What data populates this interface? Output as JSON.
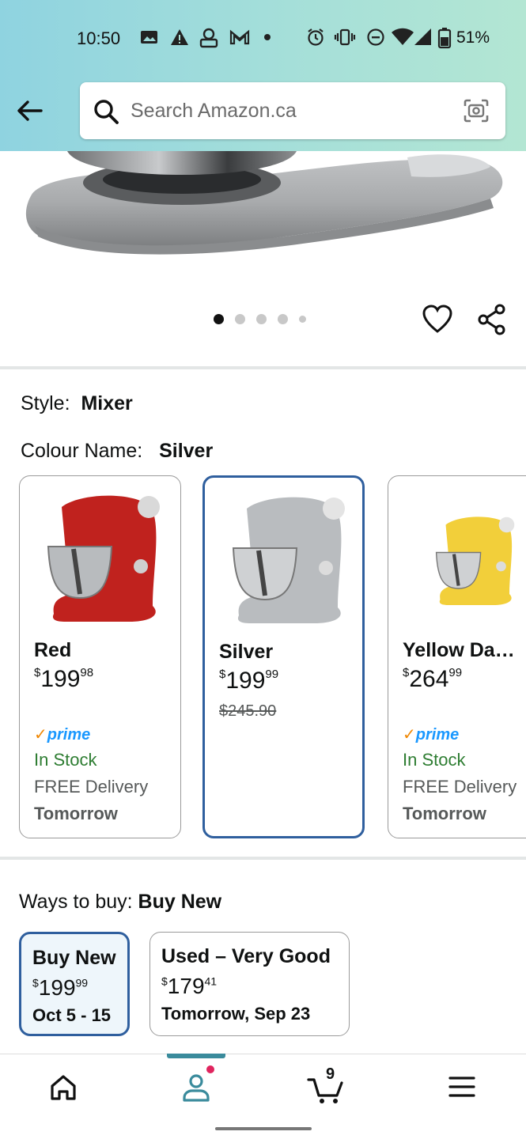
{
  "status_bar": {
    "time": "10:50",
    "battery": "51%"
  },
  "search": {
    "placeholder": "Search Amazon.ca"
  },
  "style": {
    "label": "Style:",
    "value": "Mixer"
  },
  "colour": {
    "label": "Colour Name:",
    "value": "Silver"
  },
  "colour_options": [
    {
      "name": "Red",
      "price_whole": "199",
      "price_cents": "98",
      "currency": "$",
      "prime": "prime",
      "stock": "In Stock",
      "delivery": "FREE Delivery",
      "when": "Tomorrow",
      "color": "#c0221e"
    },
    {
      "name": "Silver",
      "price_whole": "199",
      "price_cents": "99",
      "currency": "$",
      "list_price": "$245.90",
      "color": "#b9bcbf"
    },
    {
      "name": "Yellow Da…",
      "price_whole": "264",
      "price_cents": "99",
      "currency": "$",
      "prime": "prime",
      "stock": "In Stock",
      "delivery": "FREE Delivery",
      "when": "Tomorrow",
      "color": "#f2cf3a"
    }
  ],
  "ways_to_buy": {
    "label": "Ways to buy:",
    "value": "Buy New",
    "options": [
      {
        "title": "Buy New",
        "currency": "$",
        "price_whole": "199",
        "price_cents": "99",
        "delivery": "Oct 5 - 15"
      },
      {
        "title": "Used – Very Good",
        "currency": "$",
        "price_whole": "179",
        "price_cents": "41",
        "delivery": "Tomorrow, Sep 23"
      }
    ]
  },
  "bottom_nav": {
    "cart_count": "9"
  },
  "colors": {
    "accent": "#2f5f9e",
    "in_stock": "#2e7d32",
    "prime": "#1a98ff",
    "header_teal": "#a5dfd9"
  }
}
